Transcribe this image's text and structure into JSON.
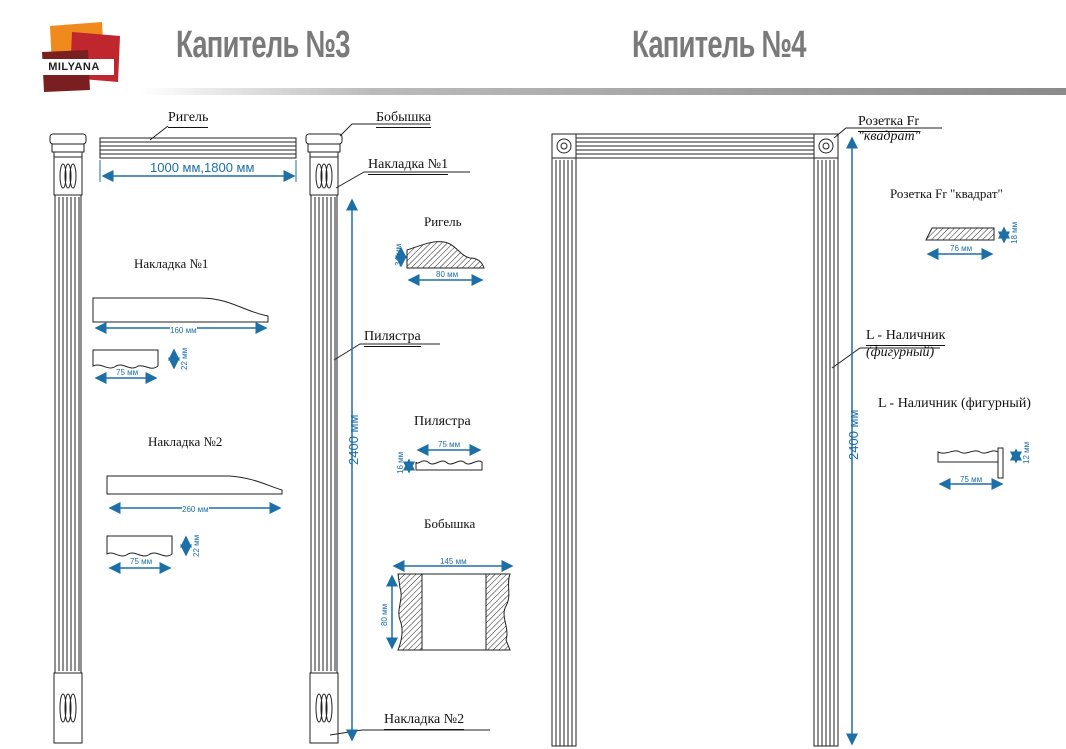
{
  "header": {
    "brand": "MILYANA",
    "title_left": "Капитель №3",
    "title_right": "Капитель №4"
  },
  "left_labels": {
    "rigel": "Ригель",
    "rigel_dim": "1000 мм,1800 мм",
    "bobyshka": "Бобышка",
    "nakladka1": "Накладка №1",
    "pilastra": "Пилястра",
    "nakladka2": "Накладка №2",
    "height": "2400 мм"
  },
  "details": {
    "nakladka1_title": "Накладка №1",
    "nakladka1_len": "160 мм",
    "nakladka1_w": "75 мм",
    "nakladka1_h": "22 мм",
    "nakladka2_title": "Накладка №2",
    "nakladka2_len": "260 мм",
    "nakladka2_w": "75 мм",
    "nakladka2_h": "22 мм",
    "rigel_title": "Ригель",
    "rigel_w": "80 мм",
    "rigel_h": "34 мм",
    "pilastra_title": "Пилястра",
    "pilastra_w": "75 мм",
    "pilastra_h": "16 мм",
    "bobyshka_title": "Бобышка",
    "bobyshka_w": "145 мм",
    "bobyshka_h": "80 мм"
  },
  "right_labels": {
    "rozetka_line1": "Розетка Fr",
    "rozetka_line2": "\"квадрат\"",
    "nalichnik_line1": "L - Наличник",
    "nalichnik_line2": "(фигурный)",
    "height": "2400 мм",
    "rozetka_title": "Розетка Fr \"квадрат\"",
    "rozetka_w": "76 мм",
    "rozetka_h": "18 мм",
    "nalichnik_title": "L - Наличник (фигурный)",
    "nalichnik_w": "75 мм",
    "nalichnik_h": "12 мм"
  },
  "colors": {
    "dimension": "#1d6fa8",
    "logo_orange": "#f08a1c",
    "logo_red": "#c0262d",
    "logo_dark": "#7a1f1f"
  }
}
